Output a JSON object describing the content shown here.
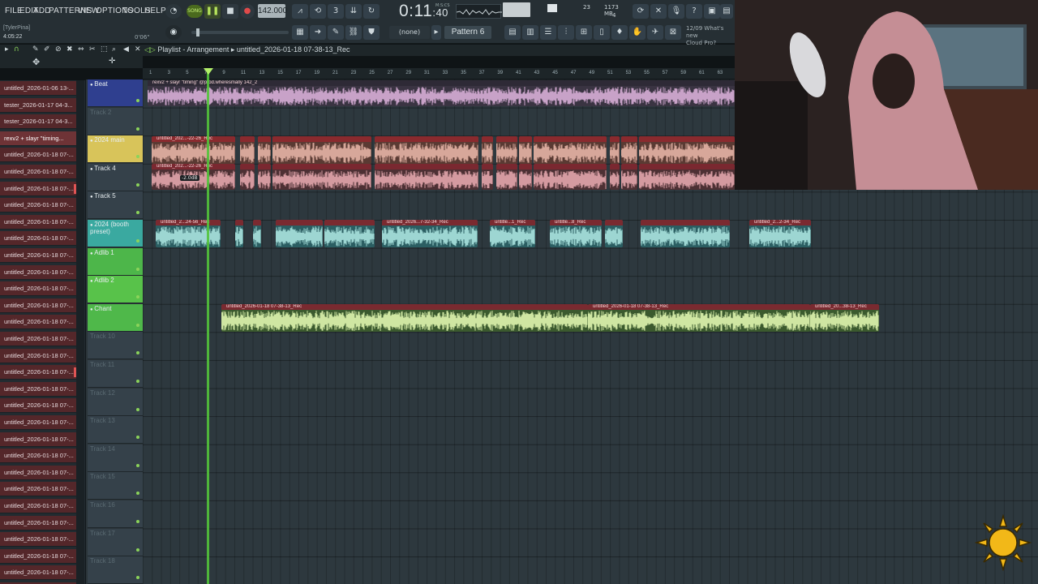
{
  "menu": [
    "FILE",
    "EDIT",
    "ADD",
    "PATTERNS",
    "VIEW",
    "OPTIONS",
    "TOOLS",
    "HELP"
  ],
  "transport": {
    "song_mode": "SONG",
    "tempo": "142.000",
    "time": "0:11",
    "time_sub": "40",
    "time_unit": "M:S:CS",
    "pattern": "Pattern 6",
    "channel_select": "(none)",
    "memory": "1173 MB",
    "cpu_count": "23",
    "voices": "4"
  },
  "hint_bar": {
    "user": "[TylerPina]",
    "position": "4:05:22",
    "zoom": "0'06\""
  },
  "news": {
    "date": "12/09",
    "text1": "What's new",
    "text2": "Cloud Pro?"
  },
  "playlist": {
    "title": "Playlist - Arrangement",
    "breadcrumb": "untitled_2026-01-18 07-38-13_Rec"
  },
  "ruler": [
    "1",
    "3",
    "5",
    "7",
    "9",
    "11",
    "13",
    "15",
    "17",
    "19",
    "21",
    "23",
    "25",
    "27",
    "29",
    "31",
    "33",
    "35",
    "37",
    "39",
    "41",
    "43",
    "45",
    "47",
    "49",
    "51",
    "53",
    "55",
    "57",
    "59",
    "61",
    "63"
  ],
  "browser_items": [
    {
      "label": "untitled_2026-01-06 13-...",
      "sel": false,
      "mark": false
    },
    {
      "label": "tester_2026-01-17 04-3...",
      "sel": false,
      "mark": false
    },
    {
      "label": "tester_2026-01-17 04-3...",
      "sel": false,
      "mark": false
    },
    {
      "label": "rexv2 + slayr \"timing...",
      "sel": true,
      "mark": false
    },
    {
      "label": "untitled_2026-01-18 07-...",
      "sel": false,
      "mark": false
    },
    {
      "label": "untitled_2026-01-18 07-...",
      "sel": false,
      "mark": false
    },
    {
      "label": "untitled_2026-01-18 07-...",
      "sel": false,
      "mark": true
    },
    {
      "label": "untitled_2026-01-18 07-...",
      "sel": false,
      "mark": false
    },
    {
      "label": "untitled_2026-01-18 07-...",
      "sel": false,
      "mark": false
    },
    {
      "label": "untitled_2026-01-18 07-...",
      "sel": false,
      "mark": false
    },
    {
      "label": "untitled_2026-01-18 07-...",
      "sel": false,
      "mark": false
    },
    {
      "label": "untitled_2026-01-18 07-...",
      "sel": false,
      "mark": false
    },
    {
      "label": "untitled_2026-01-18 07-...",
      "sel": false,
      "mark": false
    },
    {
      "label": "untitled_2026-01-18 07-...",
      "sel": false,
      "mark": false
    },
    {
      "label": "untitled_2026-01-18 07-...",
      "sel": false,
      "mark": false
    },
    {
      "label": "untitled_2026-01-18 07-...",
      "sel": false,
      "mark": false
    },
    {
      "label": "untitled_2026-01-18 07-...",
      "sel": false,
      "mark": false
    },
    {
      "label": "untitled_2026-01-18 07-...",
      "sel": false,
      "mark": true
    },
    {
      "label": "untitled_2026-01-18 07-...",
      "sel": false,
      "mark": false
    },
    {
      "label": "untitled_2026-01-18 07-...",
      "sel": false,
      "mark": false
    },
    {
      "label": "untitled_2026-01-18 07-...",
      "sel": false,
      "mark": false
    },
    {
      "label": "untitled_2026-01-18 07-...",
      "sel": false,
      "mark": false
    },
    {
      "label": "untitled_2026-01-18 07-...",
      "sel": false,
      "mark": false
    },
    {
      "label": "untitled_2026-01-18 07-...",
      "sel": false,
      "mark": false
    },
    {
      "label": "untitled_2026-01-18 07-...",
      "sel": false,
      "mark": false
    },
    {
      "label": "untitled_2026-01-18 07-...",
      "sel": false,
      "mark": false
    },
    {
      "label": "untitled_2026-01-18 07-...",
      "sel": false,
      "mark": false
    },
    {
      "label": "untitled_2026-01-18 07-...",
      "sel": false,
      "mark": false
    },
    {
      "label": "untitled_2026-01-18 07-...",
      "sel": false,
      "mark": false
    },
    {
      "label": "untitled_2026-01-18 07-...",
      "sel": false,
      "mark": false
    },
    {
      "label": "untitled_2025-01-18 07-...",
      "sel": false,
      "mark": false
    }
  ],
  "tracks": [
    {
      "name": "Beat",
      "color": "#2f3f8f",
      "named": true
    },
    {
      "name": "Track 2",
      "color": "",
      "named": false
    },
    {
      "name": "2024 main",
      "color": "#d8c45a",
      "named": true
    },
    {
      "name": "Track 4",
      "color": "",
      "named": true
    },
    {
      "name": "Track 5",
      "color": "",
      "named": true
    },
    {
      "name": "2024 (booth preset)",
      "color": "#3aa9a0",
      "named": true
    },
    {
      "name": "Adlib 1",
      "color": "#4db64a",
      "named": true
    },
    {
      "name": "Adlib 2",
      "color": "#58c24a",
      "named": true
    },
    {
      "name": "Chant",
      "color": "#4fb84a",
      "named": true
    },
    {
      "name": "Track 10",
      "color": "",
      "named": false
    },
    {
      "name": "Track 11",
      "color": "",
      "named": false
    },
    {
      "name": "Track 12",
      "color": "",
      "named": false
    },
    {
      "name": "Track 13",
      "color": "",
      "named": false
    },
    {
      "name": "Track 14",
      "color": "",
      "named": false
    },
    {
      "name": "Track 15",
      "color": "",
      "named": false
    },
    {
      "name": "Track 16",
      "color": "",
      "named": false
    },
    {
      "name": "Track 17",
      "color": "",
      "named": false
    },
    {
      "name": "Track 18",
      "color": "",
      "named": false
    }
  ],
  "clip_labels": {
    "beat": "rexv2 + slayr \"timing\" @prod.wheresmally 142_2",
    "main": "untitled_202...-22-26_Rec",
    "gain": "-2.0dB",
    "booth": [
      "untitled_2...24-56_Rec",
      "untitled_2026...7-32-34_Rec",
      "untitle...1_Rec",
      "untitle...8_Rec",
      "untitled_2...2-34_Rec"
    ],
    "chant": [
      "untitled_2026-01-18 07-38-13_Rec",
      "untitled_2026-01-18 07-38-13_Rec",
      "untitled_20...38-13_Rec"
    ]
  },
  "icons": {
    "sun": "sun-icon",
    "webcam": "webcam-overlay"
  }
}
